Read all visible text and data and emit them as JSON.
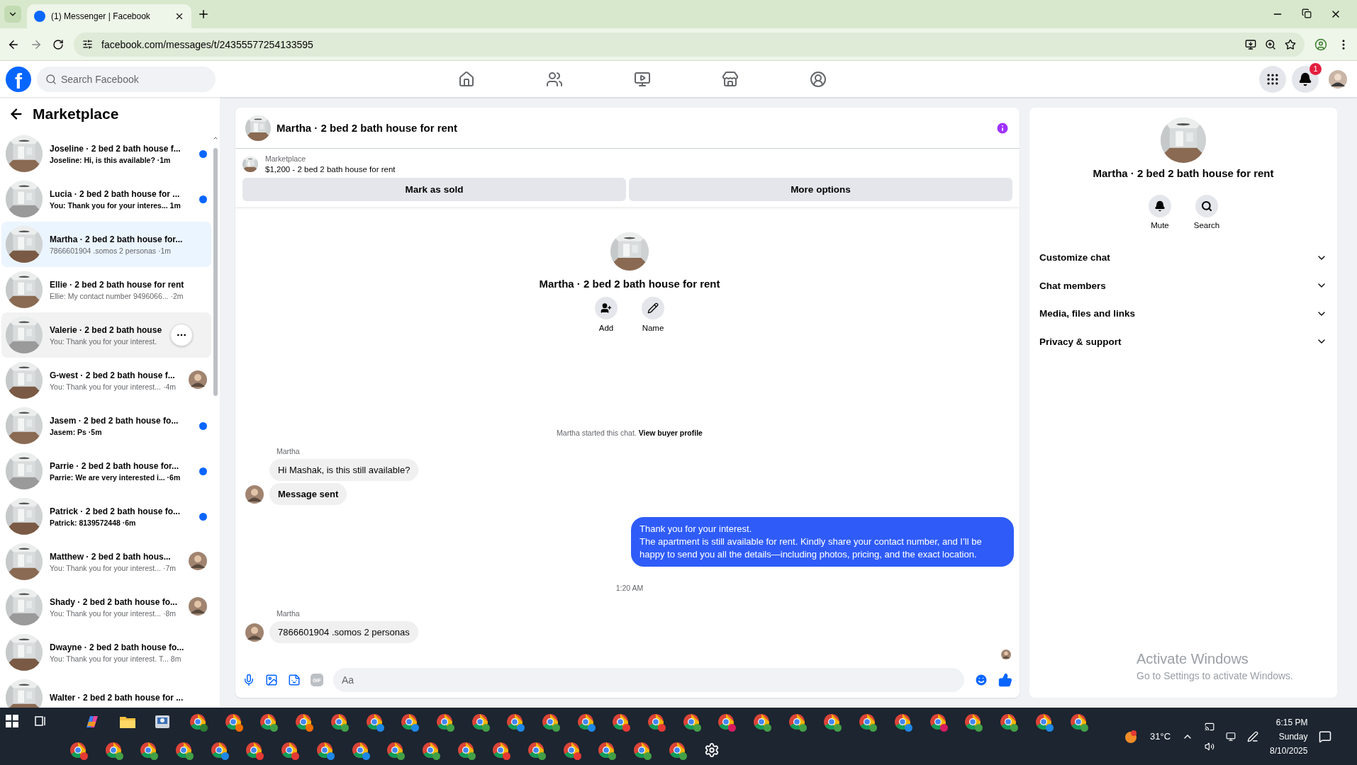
{
  "browser": {
    "tab_title": "(1) Messenger | Facebook",
    "url": "facebook.com/messages/t/24355577254133595"
  },
  "header": {
    "logo_letter": "f",
    "search_placeholder": "Search Facebook",
    "notification_count": "1"
  },
  "sidebar": {
    "title": "Marketplace"
  },
  "conversations": [
    {
      "title": "Joseline · 2 bed 2 bath house f...",
      "preview": "Joseline: Hi, is this available?",
      "time": "·1m",
      "unread": true,
      "seen": false,
      "selected": false,
      "hovered": false
    },
    {
      "title": "Lucia · 2 bed 2 bath house for ...",
      "preview": "You: Thank you for your interes...",
      "time": "1m",
      "unread": true,
      "seen": false,
      "selected": false,
      "hovered": false
    },
    {
      "title": "Martha · 2 bed 2 bath house for...",
      "preview": "7866601904 .somos 2 personas",
      "time": "·1m",
      "unread": false,
      "seen": false,
      "selected": true,
      "hovered": false
    },
    {
      "title": "Ellie · 2 bed 2 bath house for rent",
      "preview": "Ellie: My contact number 9496066...",
      "time": "·2m",
      "unread": false,
      "seen": false,
      "selected": false,
      "hovered": false
    },
    {
      "title": "Valerie · 2 bed 2 bath house",
      "preview": "You: Thank you for your interest.",
      "unread": false,
      "seen": false,
      "selected": false,
      "hovered": true
    },
    {
      "title": "G-west · 2 bed 2 bath house f...",
      "preview": "You: Thank you for your interest...",
      "time": "·4m",
      "unread": false,
      "seen": true,
      "selected": false,
      "hovered": false
    },
    {
      "title": "Jasem · 2 bed 2 bath house fo...",
      "preview": "Jasem: Ps",
      "time": "·5m",
      "unread": true,
      "seen": false,
      "selected": false,
      "hovered": false
    },
    {
      "title": "Parrie · 2 bed 2 bath house for...",
      "preview": "Parrie: We are very interested i...",
      "time": "·6m",
      "unread": true,
      "seen": false,
      "selected": false,
      "hovered": false
    },
    {
      "title": "Patrick · 2 bed 2 bath house fo...",
      "preview": "Patrick: 8139572448",
      "time": "·6m",
      "unread": true,
      "seen": false,
      "selected": false,
      "hovered": false
    },
    {
      "title": "Matthew · 2 bed 2 bath hous...",
      "preview": "You: Thank you for your interest...",
      "time": "·7m",
      "unread": false,
      "seen": true,
      "selected": false,
      "hovered": false
    },
    {
      "title": "Shady · 2 bed 2 bath house fo...",
      "preview": "You: Thank you for your interest...",
      "time": "·8m",
      "unread": false,
      "seen": true,
      "selected": false,
      "hovered": false
    },
    {
      "title": "Dwayne · 2 bed 2 bath house fo...",
      "preview": "You: Thank you for your interest. T...",
      "time": "8m",
      "unread": false,
      "seen": false,
      "selected": false,
      "hovered": false
    },
    {
      "title": "Walter · 2 bed 2 bath house for ...",
      "unread": false,
      "seen": false,
      "selected": false,
      "hovered": false
    }
  ],
  "chat": {
    "title": "Martha · 2 bed 2 bath house for rent",
    "listing": {
      "source": "Marketplace",
      "summary": "$1,200 - 2 bed 2 bath house for rent"
    },
    "actions": [
      "Mark as sold",
      "More options"
    ],
    "profile": {
      "name": "Martha · 2 bed 2 bath house for rent",
      "buttons": [
        {
          "kind": "add",
          "label": "Add"
        },
        {
          "kind": "name",
          "label": "Name"
        }
      ]
    },
    "started_note": {
      "text": "Martha started this chat.",
      "link": "View buyer profile"
    },
    "messages": [
      {
        "kind": "sender",
        "text": "Martha"
      },
      {
        "kind": "incoming",
        "text": "Hi Mashak, is this still available?",
        "avatar": false,
        "bold": false
      },
      {
        "kind": "incoming",
        "text": "Message sent",
        "avatar": true,
        "bold": true
      },
      {
        "kind": "outgoing",
        "lines": [
          "Thank you for your interest.",
          "The apartment is still available for rent. Kindly share your contact number, and I’ll be happy to send you all the details—including photos, pricing, and the exact location."
        ]
      },
      {
        "kind": "time",
        "text": "1:20 AM"
      },
      {
        "kind": "sender",
        "text": "Martha"
      },
      {
        "kind": "incoming",
        "text": "7866601904 .somos 2 personas",
        "avatar": true,
        "bold": false
      },
      {
        "kind": "seen"
      }
    ],
    "composer": {
      "placeholder": "Aa",
      "gif_label": "GIF"
    }
  },
  "details": {
    "name": "Martha · 2 bed 2 bath house for rent",
    "buttons": [
      {
        "kind": "mute",
        "label": "Mute"
      },
      {
        "kind": "search",
        "label": "Search"
      }
    ],
    "sections": [
      {
        "label": "Customize chat",
        "expanded": false
      },
      {
        "label": "Chat members",
        "expanded": false
      },
      {
        "label": "Media, files and links",
        "expanded": false
      },
      {
        "label": "Privacy & support",
        "expanded": false
      }
    ]
  },
  "activation": {
    "title": "Activate Windows",
    "text": "Go to Settings to activate Windows."
  },
  "taskbar": {
    "row1": [
      {
        "kind": "copilot"
      },
      {
        "kind": "explorer"
      },
      {
        "kind": "app"
      },
      {
        "kind": "chrome",
        "color": "#2e7d32"
      },
      {
        "kind": "chrome",
        "color": "#ef6c00"
      },
      {
        "kind": "chrome",
        "color": "#43a047"
      },
      {
        "kind": "chrome",
        "color": "#ef6c00"
      },
      {
        "kind": "chrome",
        "color": "#43a047"
      },
      {
        "kind": "chrome",
        "color": "#1e88e5"
      },
      {
        "kind": "chrome",
        "color": "#1e88e5"
      },
      {
        "kind": "chrome",
        "color": "#43a047"
      },
      {
        "kind": "chrome",
        "color": "#43a047"
      },
      {
        "kind": "chrome",
        "color": "#1e88e5"
      },
      {
        "kind": "chrome",
        "color": "#43a047"
      },
      {
        "kind": "chrome",
        "color": "#1e88e5"
      },
      {
        "kind": "chrome",
        "color": "#e53935"
      },
      {
        "kind": "chrome",
        "color": "#e53935"
      },
      {
        "kind": "chrome",
        "color": "#43a047"
      },
      {
        "kind": "chrome",
        "color": "#d81b60"
      },
      {
        "kind": "chrome",
        "color": "#43a047"
      },
      {
        "kind": "chrome",
        "color": "#43a047"
      },
      {
        "kind": "chrome",
        "color": "#43a047"
      },
      {
        "kind": "chrome",
        "color": "#43a047"
      },
      {
        "kind": "chrome",
        "color": "#1e88e5"
      },
      {
        "kind": "chrome",
        "color": "#d81b60"
      },
      {
        "kind": "chrome",
        "color": "#43a047"
      },
      {
        "kind": "chrome",
        "color": "#43a047"
      },
      {
        "kind": "chrome",
        "color": "#1e88e5"
      },
      {
        "kind": "chrome",
        "color": "#43a047"
      }
    ],
    "row2": [
      {
        "kind": "chrome",
        "color": "#e53935"
      },
      {
        "kind": "chrome",
        "color": "#43a047"
      },
      {
        "kind": "chrome",
        "color": "#43a047"
      },
      {
        "kind": "chrome",
        "color": "#43a047"
      },
      {
        "kind": "chrome",
        "color": "#1e88e5"
      },
      {
        "kind": "chrome",
        "color": "#e53935"
      },
      {
        "kind": "chrome",
        "color": "#e53935"
      },
      {
        "kind": "chrome",
        "color": "#1e88e5"
      },
      {
        "kind": "chrome",
        "color": "#1e88e5"
      },
      {
        "kind": "chrome",
        "color": "#43a047"
      },
      {
        "kind": "chrome",
        "color": "#43a047"
      },
      {
        "kind": "chrome",
        "color": "#43a047"
      },
      {
        "kind": "chrome",
        "color": "#e53935"
      },
      {
        "kind": "chrome",
        "color": "#43a047"
      },
      {
        "kind": "chrome",
        "color": "#e53935"
      },
      {
        "kind": "chrome",
        "color": "#43a047"
      },
      {
        "kind": "chrome",
        "color": "#43a047"
      },
      {
        "kind": "chrome",
        "color": "#43a047"
      },
      {
        "kind": "settings"
      }
    ],
    "temperature": "31°C",
    "time": "6:15 PM",
    "day": "Sunday",
    "date": "8/10/2025"
  }
}
